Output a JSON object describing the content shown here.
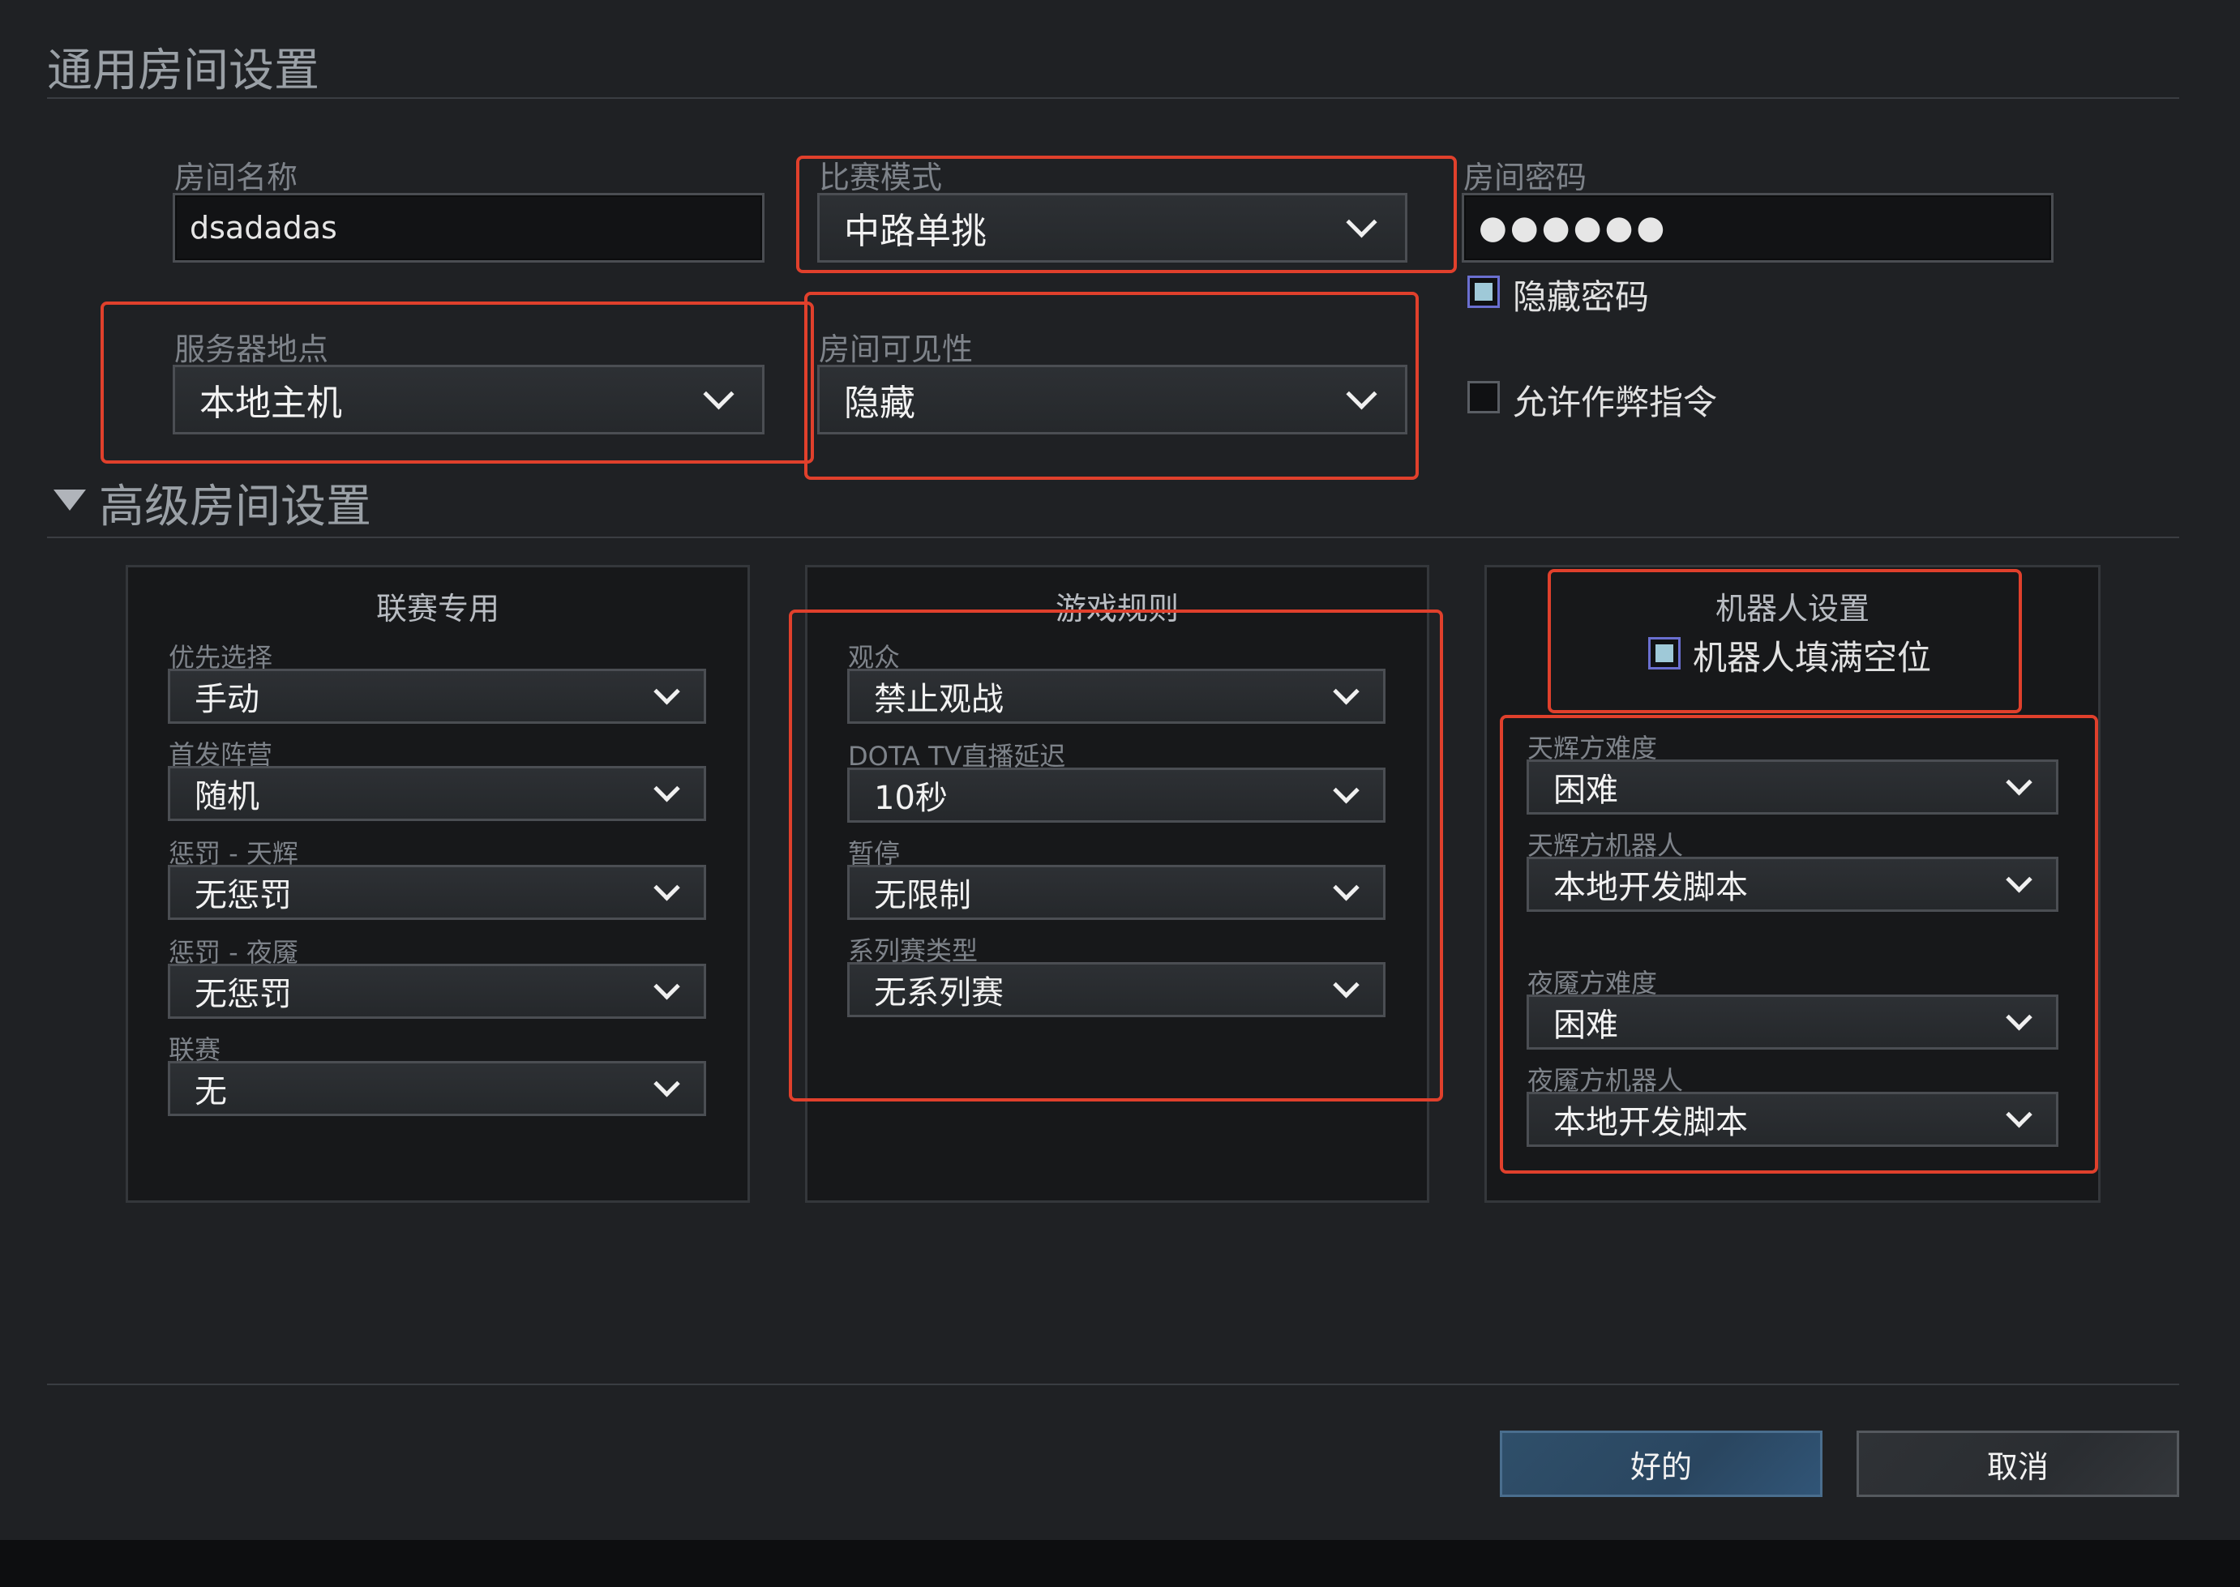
{
  "general": {
    "title": "通用房间设置",
    "room_name": {
      "label": "房间名称",
      "value": "dsadadas"
    },
    "game_mode": {
      "label": "比赛模式",
      "value": "中路单挑"
    },
    "password": {
      "label": "房间密码",
      "value": "●●●●●●"
    },
    "hide_password": {
      "label": "隐藏密码",
      "checked": true
    },
    "server": {
      "label": "服务器地点",
      "value": "本地主机"
    },
    "visibility": {
      "label": "房间可见性",
      "value": "隐藏"
    },
    "allow_cheats": {
      "label": "允许作弊指令",
      "checked": false
    }
  },
  "advanced": {
    "title": "高级房间设置",
    "league": {
      "title": "联赛专用",
      "fields": [
        {
          "label": "优先选择",
          "value": "手动"
        },
        {
          "label": "首发阵营",
          "value": "随机"
        },
        {
          "label": "惩罚 - 天辉",
          "value": "无惩罚"
        },
        {
          "label": "惩罚 - 夜魇",
          "value": "无惩罚"
        },
        {
          "label": "联赛",
          "value": "无"
        }
      ]
    },
    "rules": {
      "title": "游戏规则",
      "fields": [
        {
          "label": "观众",
          "value": "禁止观战"
        },
        {
          "label": "DOTA TV直播延迟",
          "value": "10秒"
        },
        {
          "label": "暂停",
          "value": "无限制"
        },
        {
          "label": "系列赛类型",
          "value": "无系列赛"
        }
      ]
    },
    "bots": {
      "title": "机器人设置",
      "fill_bots": {
        "label": "机器人填满空位",
        "checked": true
      },
      "fields": [
        {
          "label": "天辉方难度",
          "value": "困难"
        },
        {
          "label": "天辉方机器人",
          "value": "本地开发脚本"
        },
        {
          "label": "夜魇方难度",
          "value": "困难"
        },
        {
          "label": "夜魇方机器人",
          "value": "本地开发脚本"
        }
      ]
    }
  },
  "buttons": {
    "ok": "好的",
    "cancel": "取消"
  },
  "colors": {
    "highlight": "#e0402c",
    "ok_button": "#2f4f6a",
    "background": "#1f2124"
  }
}
